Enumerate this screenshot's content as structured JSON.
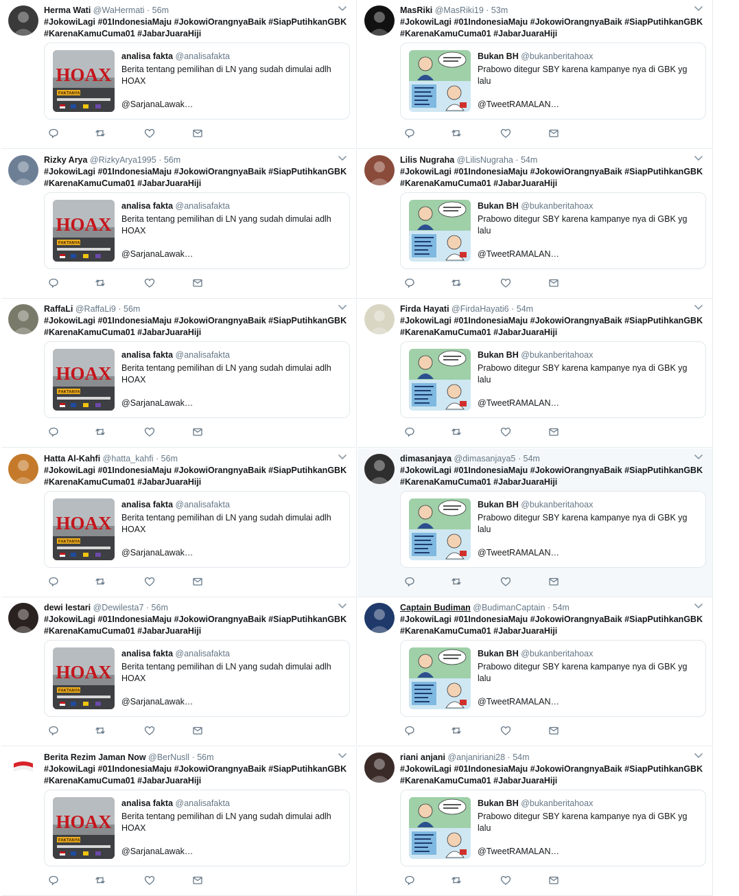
{
  "quotes": {
    "hoax": {
      "name": "analisa fakta",
      "handle": "@analisafakta",
      "text": "Berita tentang pemilihan di LN yang sudah dimulai adlh HOAX",
      "more": "@SarjanaLawak…",
      "thumb_label": "HOAX",
      "thumb_tag": "FAKTANYA"
    },
    "prabowo": {
      "name": "Bukan BH",
      "handle": "@bukanberitahoax",
      "text": "Prabowo ditegur SBY karena kampanye nya di GBK yg lalu",
      "more": "@TweetRAMALAN…"
    }
  },
  "tweets": [
    {
      "name": "Herma Wati",
      "handle": "@WaHermati",
      "time": "56m",
      "hashtags": "#JokowiLagi #01IndonesiaMaju #JokowiOrangnyaBaik #SiapPutihkanGBK #KarenaKamuCuma01 #JabarJuaraHiji",
      "quote": "hoax",
      "avatar_color": "#3a3a3a"
    },
    {
      "name": "MasRiki",
      "handle": "@MasRiki19",
      "time": "53m",
      "hashtags": "#JokowiLagi #01IndonesiaMaju #JokowiOrangnyaBaik #SiapPutihkanGBK #KarenaKamuCuma01 #JabarJuaraHiji",
      "quote": "prabowo",
      "avatar_color": "#111111"
    },
    {
      "name": "Rizky Arya",
      "handle": "@RizkyArya1995",
      "time": "56m",
      "hashtags": "#JokowiLagi #01IndonesiaMaju #JokowiOrangnyaBaik #SiapPutihkanGBK #KarenaKamuCuma01 #JabarJuaraHiji",
      "quote": "hoax",
      "avatar_color": "#6d7f95"
    },
    {
      "name": "Lilis Nugraha",
      "handle": "@LilisNugraha",
      "time": "54m",
      "hashtags": "#JokowiLagi #01IndonesiaMaju #JokowiOrangnyaBaik #SiapPutihkanGBK #KarenaKamuCuma01 #JabarJuaraHiji",
      "quote": "prabowo",
      "avatar_color": "#8a4b3a"
    },
    {
      "name": "RaffaLi",
      "handle": "@RaffaLi9",
      "time": "56m",
      "hashtags": "#JokowiLagi #01IndonesiaMaju #JokowiOrangnyaBaik #SiapPutihkanGBK #KarenaKamuCuma01 #JabarJuaraHiji",
      "quote": "hoax",
      "avatar_color": "#7a7a6a"
    },
    {
      "name": "Firda Hayati",
      "handle": "@FirdaHayati6",
      "time": "54m",
      "hashtags": "#JokowiLagi #01IndonesiaMaju #JokowiOrangnyaBaik #SiapPutihkanGBK #KarenaKamuCuma01 #JabarJuaraHiji",
      "quote": "prabowo",
      "avatar_color": "#d9d6c4"
    },
    {
      "name": "Hatta Al-Kahfi",
      "handle": "@hatta_kahfi",
      "time": "56m",
      "hashtags": "#JokowiLagi #01IndonesiaMaju #JokowiOrangnyaBaik #SiapPutihkanGBK #KarenaKamuCuma01 #JabarJuaraHiji",
      "quote": "hoax",
      "avatar_color": "#c47a2a"
    },
    {
      "name": "dimasanjaya",
      "handle": "@dimasanjaya5",
      "time": "54m",
      "hashtags": "#JokowiLagi #01IndonesiaMaju #JokowiOrangnyaBaik #SiapPutihkanGBK #KarenaKamuCuma01 #JabarJuaraHiji",
      "quote": "prabowo",
      "avatar_color": "#2e2e2e",
      "highlight": true
    },
    {
      "name": "dewi lestari",
      "handle": "@Dewilesta7",
      "time": "56m",
      "hashtags": "#JokowiLagi #01IndonesiaMaju #JokowiOrangnyaBaik #SiapPutihkanGBK #KarenaKamuCuma01 #JabarJuaraHiji",
      "quote": "hoax",
      "avatar_color": "#2a2220"
    },
    {
      "name": "Captain Budiman",
      "handle": "@BudimanCaptain",
      "time": "54m",
      "hashtags": "#JokowiLagi #01IndonesiaMaju #JokowiOrangnyaBaik #SiapPutihkanGBK #KarenaKamuCuma01 #JabarJuaraHiji",
      "quote": "prabowo",
      "avatar_color": "#1f3a6a",
      "underline": true
    },
    {
      "name": "Berita Rezim Jaman Now",
      "handle": "@BerNusll",
      "time": "56m",
      "hashtags": "#JokowiLagi #01IndonesiaMaju #JokowiOrangnyaBaik #SiapPutihkanGBK #KarenaKamuCuma01 #JabarJuaraHiji",
      "quote": "hoax",
      "avatar_color": "#ffffff",
      "flag": true
    },
    {
      "name": "riani anjani",
      "handle": "@anjaniriani28",
      "time": "54m",
      "hashtags": "#JokowiLagi #01IndonesiaMaju #JokowiOrangnyaBaik #SiapPutihkanGBK #KarenaKamuCuma01 #JabarJuaraHiji",
      "quote": "prabowo",
      "avatar_color": "#3a2a28"
    }
  ],
  "colors": {
    "hoax_red": "#c4161c",
    "border": "#e1e8ed",
    "muted": "#657786",
    "highlight_bg": "#f5f8fa"
  },
  "icons": [
    "reply-icon",
    "retweet-icon",
    "like-icon",
    "dm-icon",
    "chevron-down-icon"
  ]
}
